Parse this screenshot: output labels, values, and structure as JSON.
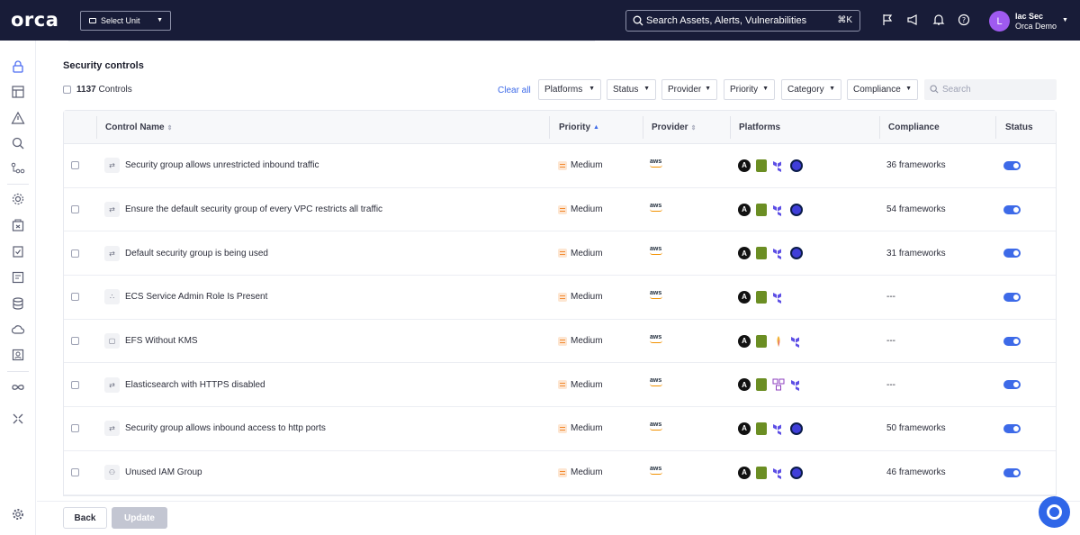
{
  "topbar": {
    "logo": "orca",
    "unit_select": "Select Unit",
    "search_placeholder": "Search Assets, Alerts, Vulnerabilities",
    "search_shortcut": "⌘K",
    "user": {
      "initial": "L",
      "name": "Iac Sec",
      "org": "Orca Demo"
    }
  },
  "page": {
    "title": "Security controls",
    "count": "1137",
    "count_label": "Controls",
    "clear_all": "Clear all",
    "filters": [
      "Platforms",
      "Status",
      "Provider",
      "Priority",
      "Category",
      "Compliance"
    ],
    "search_placeholder": "Search"
  },
  "table": {
    "columns": [
      "Control Name",
      "Priority",
      "Provider",
      "Platforms",
      "Compliance",
      "Status"
    ],
    "rows": [
      {
        "name": "Security group allows unrestricted inbound traffic",
        "icon": "sliders-icon",
        "priority": "Medium",
        "provider": "aws",
        "platforms": [
          "ansible",
          "chef",
          "terraform",
          "pulumi"
        ],
        "compliance": "36 frameworks"
      },
      {
        "name": "Ensure the default security group of every VPC restricts all traffic",
        "icon": "sliders-icon",
        "priority": "Medium",
        "provider": "aws",
        "platforms": [
          "ansible",
          "chef",
          "terraform",
          "pulumi"
        ],
        "compliance": "54 frameworks"
      },
      {
        "name": "Default security group is being used",
        "icon": "sliders-icon",
        "priority": "Medium",
        "provider": "aws",
        "platforms": [
          "ansible",
          "chef",
          "terraform",
          "pulumi"
        ],
        "compliance": "31 frameworks"
      },
      {
        "name": "ECS Service Admin Role Is Present",
        "icon": "nodes-icon",
        "priority": "Medium",
        "provider": "aws",
        "platforms": [
          "ansible",
          "chef",
          "terraform"
        ],
        "compliance": "---"
      },
      {
        "name": "EFS Without KMS",
        "icon": "file-icon",
        "priority": "Medium",
        "provider": "aws",
        "platforms": [
          "ansible",
          "chef",
          "cdk",
          "terraform"
        ],
        "compliance": "---"
      },
      {
        "name": "Elasticsearch with HTTPS disabled",
        "icon": "sliders-icon",
        "priority": "Medium",
        "provider": "aws",
        "platforms": [
          "ansible",
          "chef",
          "other",
          "terraform"
        ],
        "compliance": "---"
      },
      {
        "name": "Security group allows inbound access to http ports",
        "icon": "sliders-icon",
        "priority": "Medium",
        "provider": "aws",
        "platforms": [
          "ansible",
          "chef",
          "terraform",
          "pulumi"
        ],
        "compliance": "50 frameworks"
      },
      {
        "name": "Unused IAM Group",
        "icon": "users-icon",
        "priority": "Medium",
        "provider": "aws",
        "platforms": [
          "ansible",
          "chef",
          "terraform",
          "pulumi"
        ],
        "compliance": "46 frameworks"
      }
    ]
  },
  "footer": {
    "back": "Back",
    "update": "Update"
  },
  "colors": {
    "topbar": "#181c38",
    "accent": "#3d6ae8",
    "medium": "#f28a30",
    "avatar": "#9f5af0"
  }
}
